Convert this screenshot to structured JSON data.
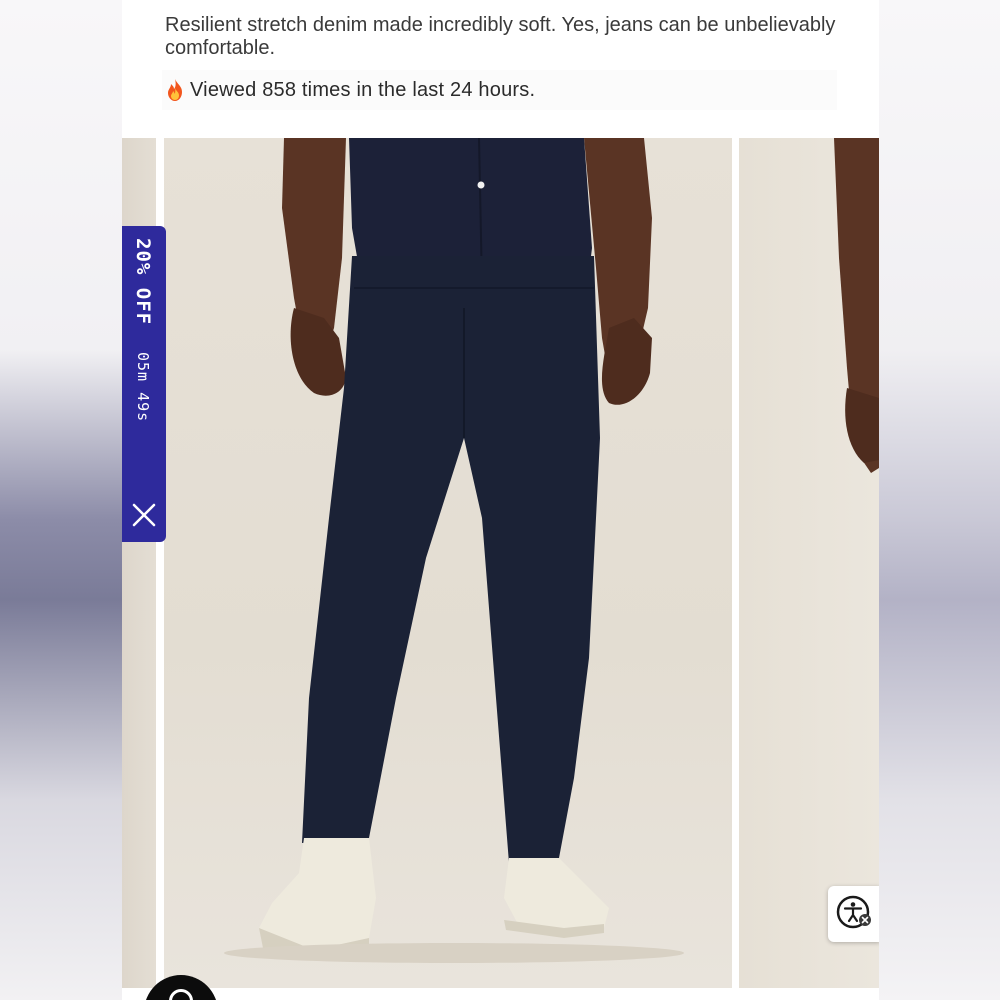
{
  "product": {
    "description": "Resilient stretch denim made incredibly soft. Yes, jeans can be unbelievably comfortable.",
    "viewed_text": "Viewed 858 times in the last 24 hours."
  },
  "icons": {
    "fire": "fire-icon",
    "close": "close-icon",
    "accessibility": "accessibility-icon"
  },
  "discount_tab": {
    "percent": "20%",
    "off": "OFF",
    "timer": "05m 49s",
    "color": "#2e2a9c"
  },
  "gallery": {
    "image_count_visible": 3,
    "main_subject": "man in navy shirt and dark rinse jeans with white sneakers"
  }
}
